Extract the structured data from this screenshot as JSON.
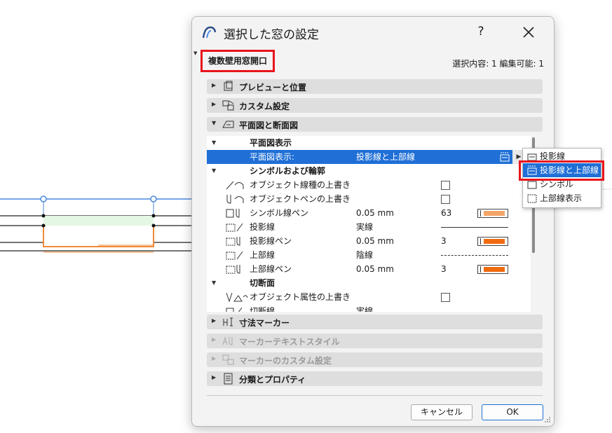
{
  "dialog": {
    "title": "選択した窓の設定",
    "help_label": "?",
    "object_name": "複数壁用窓開口",
    "selection_info": "選択内容: 1 編集可能: 1"
  },
  "sections_top": [
    {
      "label": "プレビューと位置",
      "icon": "preview-icon",
      "expanded": false
    },
    {
      "label": "カスタム設定",
      "icon": "custom-settings-icon",
      "expanded": false
    },
    {
      "label": "平面図と断面図",
      "icon": "floor-plan-section-icon",
      "expanded": true
    }
  ],
  "tree": {
    "group_floor_display": "平面図表示",
    "selected_row": {
      "name": "平面図表示:",
      "value": "投影線と上部線"
    },
    "group_symbol": "シンボルおよび輪郭",
    "rows": [
      {
        "name": "オブジェクト線種の上書き",
        "value": "",
        "extra": ""
      },
      {
        "name": "オブジェクトペンの上書き",
        "value": "",
        "extra": ""
      },
      {
        "name": "シンボル線ペン",
        "value": "0.05 mm",
        "extra": "63",
        "pen_color": "#f4a466"
      },
      {
        "name": "投影線",
        "value": "実線",
        "extra": ""
      },
      {
        "name": "投影線ペン",
        "value": "0.05 mm",
        "extra": "3",
        "pen_color": "#f06a10"
      },
      {
        "name": "上部線",
        "value": "陰線",
        "extra": ""
      },
      {
        "name": "上部線ペン",
        "value": "0.05 mm",
        "extra": "3",
        "pen_color": "#f06a10"
      }
    ],
    "group_cut": "切断面",
    "cut_rows": [
      {
        "name": "オブジェクト属性の上書き",
        "value": ""
      },
      {
        "name": "切断線",
        "value": "実線"
      }
    ]
  },
  "sections_bottom": [
    {
      "label": "寸法マーカー",
      "icon": "dimension-marker-icon",
      "enabled": true
    },
    {
      "label": "マーカーテキストスタイル",
      "icon": "marker-text-style-icon",
      "enabled": false
    },
    {
      "label": "マーカーのカスタム設定",
      "icon": "marker-custom-icon",
      "enabled": false
    },
    {
      "label": "分類とプロパティ",
      "icon": "classification-icon",
      "enabled": true
    }
  ],
  "buttons": {
    "cancel": "キャンセル",
    "ok": "OK"
  },
  "popup": {
    "items": [
      {
        "label": "投影線",
        "active": false
      },
      {
        "label": "投影線と上部線",
        "active": true
      },
      {
        "label": "シンボル",
        "active": false
      },
      {
        "label": "上部線表示",
        "active": false
      }
    ]
  },
  "colors": {
    "accent": "#1f6fd6",
    "highlight": "#e8141b",
    "pen_orange": "#f06a10",
    "pen_light": "#f4a466"
  }
}
